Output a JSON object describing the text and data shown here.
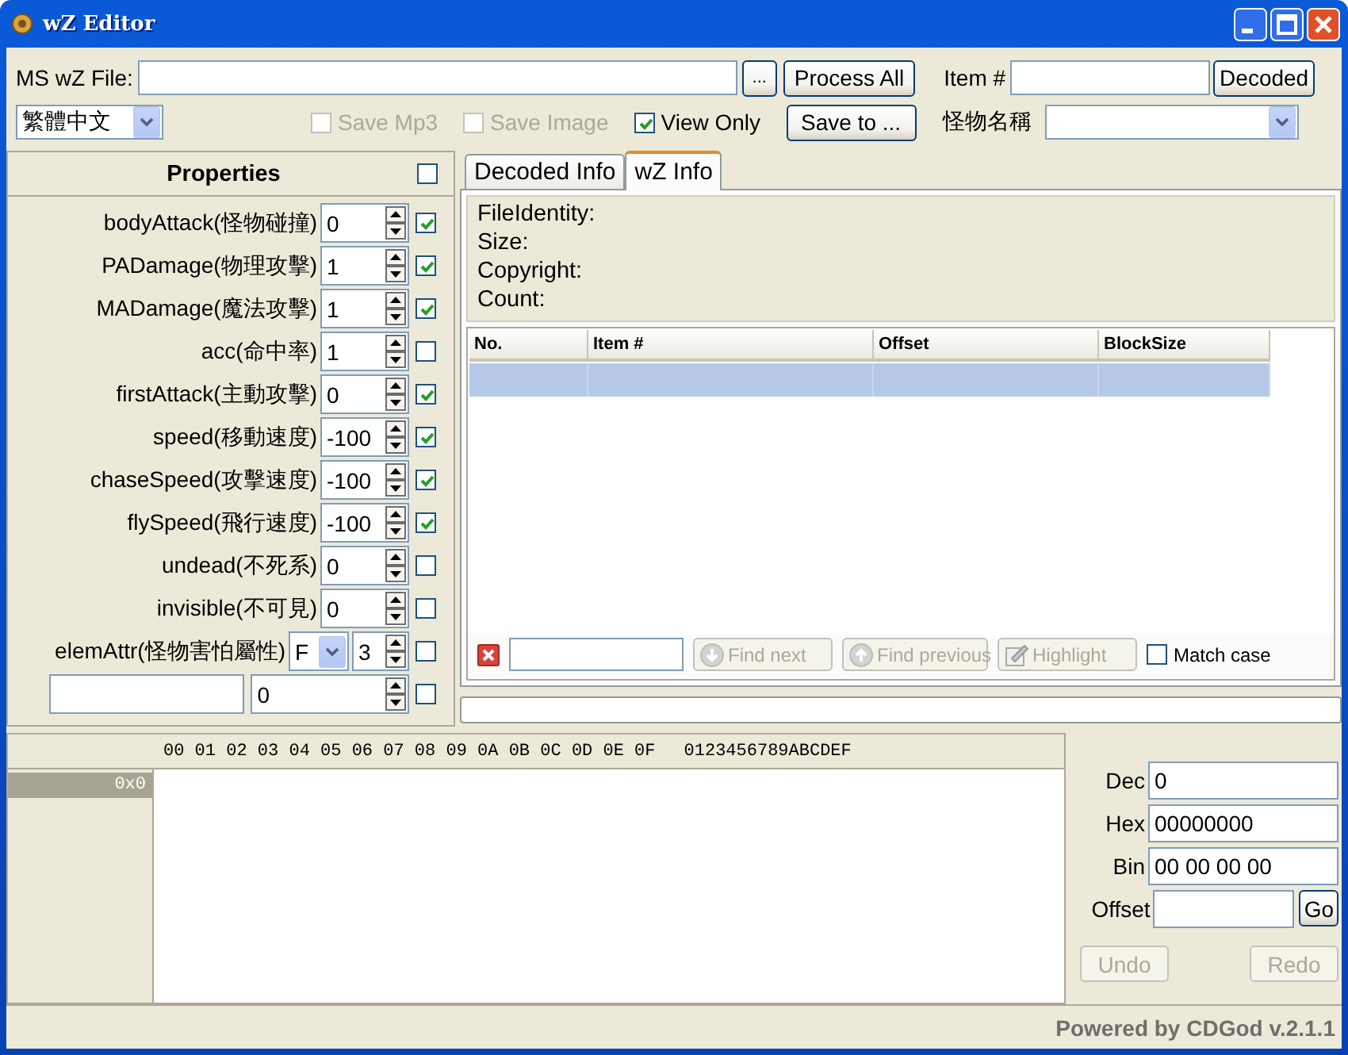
{
  "window": {
    "title": "wZ Editor"
  },
  "toolbar": {
    "file_label": "MS wZ File:",
    "browse_button": "...",
    "process_button": "Process All",
    "item_label": "Item #",
    "decoded_button": "Decoded",
    "language": "繁體中文",
    "options": [
      {
        "label": "Save Mp3",
        "checked": false,
        "disabled": true
      },
      {
        "label": "Save Image",
        "checked": false,
        "disabled": true
      },
      {
        "label": "View Only",
        "checked": true,
        "disabled": false
      }
    ],
    "save_button": "Save to ...",
    "monster_label": "怪物名稱"
  },
  "properties": {
    "title": "Properties",
    "checked": false,
    "rows": [
      {
        "kind": "spin",
        "label": "bodyAttack(怪物碰撞)",
        "value": "0",
        "checked": true
      },
      {
        "kind": "spin",
        "label": "PADamage(物理攻擊)",
        "value": "1",
        "checked": true
      },
      {
        "kind": "spin",
        "label": "MADamage(魔法攻擊)",
        "value": "1",
        "checked": true
      },
      {
        "kind": "spin",
        "label": "acc(命中率)",
        "value": "1",
        "checked": false
      },
      {
        "kind": "spin",
        "label": "firstAttack(主動攻擊)",
        "value": "0",
        "checked": true
      },
      {
        "kind": "spin",
        "label": "speed(移動速度)",
        "value": "-100",
        "checked": true
      },
      {
        "kind": "spin",
        "label": "chaseSpeed(攻擊速度)",
        "value": "-100",
        "checked": true
      },
      {
        "kind": "spin",
        "label": "flySpeed(飛行速度)",
        "value": "-100",
        "checked": true
      },
      {
        "kind": "spin",
        "label": "undead(不死系)",
        "value": "0",
        "checked": false
      },
      {
        "kind": "spin",
        "label": "invisible(不可見)",
        "value": "0",
        "checked": false
      },
      {
        "kind": "element",
        "label": "elemAttr(怪物害怕屬性)",
        "element": "F",
        "value": "3",
        "checked": false
      },
      {
        "kind": "custom",
        "value": "0",
        "checked": false
      }
    ]
  },
  "tabs": [
    {
      "label": "Decoded Info",
      "selected": false
    },
    {
      "label": "wZ Info",
      "selected": true
    }
  ],
  "info": [
    "FileIdentity:",
    "Size:",
    "Copyright:",
    "Count:"
  ],
  "table": {
    "columns": [
      "No.",
      "Item #",
      "Offset",
      "BlockSize"
    ],
    "rows": [
      {
        "selected": true
      }
    ]
  },
  "search": {
    "buttons": [
      {
        "kind": "next",
        "label": "Find next",
        "disabled": true
      },
      {
        "kind": "previous",
        "label": "Find previous",
        "disabled": true
      },
      {
        "kind": "highlight",
        "label": "Highlight",
        "disabled": true
      }
    ],
    "match_case": {
      "label": "Match case",
      "checked": false
    }
  },
  "hex": {
    "column_header": "00 01 02 03 04 05 06 07 08 09 0A 0B 0C 0D 0E 0F",
    "ascii_header": "0123456789ABCDEF",
    "rows": [
      {
        "offset": "0x0",
        "selected": true
      }
    ]
  },
  "inspector": {
    "fields": [
      {
        "label": "Dec",
        "value": "0"
      },
      {
        "label": "Hex",
        "value": "00000000"
      },
      {
        "label": "Bin",
        "value": "00 00 00 00"
      },
      {
        "label": "Offset"
      }
    ],
    "go_button": "Go",
    "undo": {
      "label": "Undo",
      "disabled": true
    },
    "redo": {
      "label": "Redo",
      "disabled": true
    }
  },
  "status": "Powered by CDGod v.2.1.1"
}
